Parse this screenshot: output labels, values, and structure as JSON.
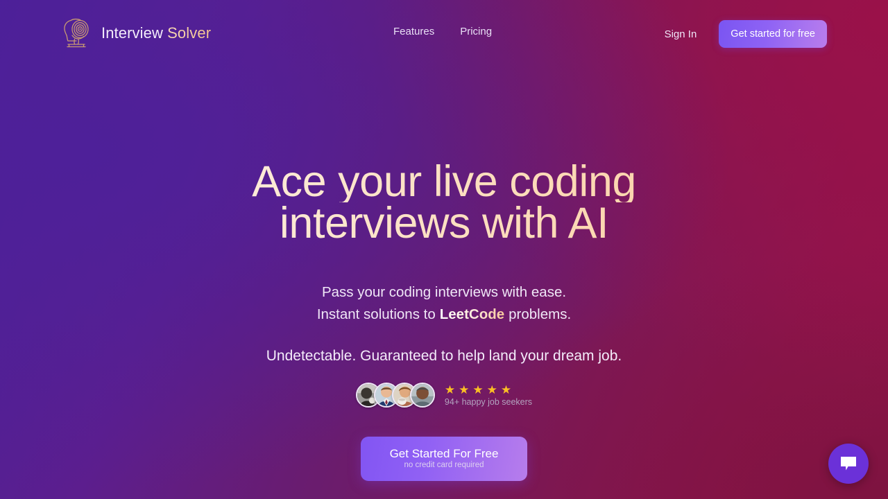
{
  "brand": {
    "logo_icon": "bust-spiral-logo-icon",
    "name_part_1": "Interview",
    "name_part_2": "Solver"
  },
  "nav": {
    "links": [
      {
        "label": "Features"
      },
      {
        "label": "Pricing"
      }
    ],
    "sign_in_label": "Sign In",
    "cta_label": "Get started for free"
  },
  "hero": {
    "title_line_1": "Ace your live coding",
    "title_line_2": "interviews with AI",
    "sub_line_1": "Pass your coding interviews with ease.",
    "sub_line_2_before": "Instant solutions to",
    "sub_line_2_highlight": "LeetCode",
    "sub_line_2_after": "problems.",
    "guarantee": "Undetectable. Guaranteed to help land your dream job."
  },
  "social_proof": {
    "avatar_count": 4,
    "stars": [
      "★",
      "★",
      "★",
      "★",
      "★"
    ],
    "star_count": 5,
    "caption": "94+ happy job seekers"
  },
  "cta": {
    "label": "Get Started For Free",
    "note": "no credit card required"
  },
  "chat": {
    "icon": "chat-bubble-icon"
  },
  "colors": {
    "bg_top_left": "#4b2199",
    "bg_top_right": "#951349",
    "bg_bottom_left": "#4b2199",
    "bg_bottom_right": "#7d1340",
    "bg_mid": "#681c6d",
    "accent_purple": "#8f63f4",
    "accent_violet": "#b77dec",
    "star_gold": "#fbbf24",
    "heading_gradient_start": "#fdf6ef",
    "heading_gradient_end": "#fac99b",
    "logo_tan": "#c89a72",
    "chat_button": "#6b31d8",
    "caption_grey": "#b3a3bf"
  }
}
